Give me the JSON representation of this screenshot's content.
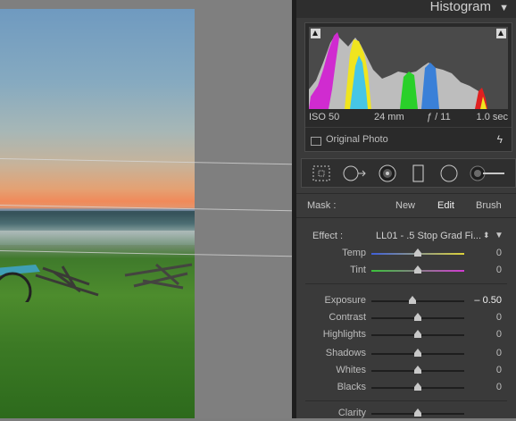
{
  "histogram": {
    "title": "Histogram",
    "exif": {
      "iso": "ISO 50",
      "focal": "24 mm",
      "aperture": "ƒ / 11",
      "shutter": "1.0 sec"
    },
    "original_photo_label": "Original Photo"
  },
  "mask": {
    "label": "Mask :",
    "new": "New",
    "edit": "Edit",
    "brush": "Brush"
  },
  "effect": {
    "label": "Effect :",
    "value": "LL01 - .5 Stop Grad Fi..."
  },
  "sliders": [
    {
      "label": "Temp",
      "value": "0",
      "position": 0.5,
      "track": "temp"
    },
    {
      "label": "Tint",
      "value": "0",
      "position": 0.5,
      "track": "tint"
    },
    {
      "label": "Exposure",
      "value": "– 0.50",
      "position": 0.44,
      "track": "plain",
      "bright": true
    },
    {
      "label": "Contrast",
      "value": "0",
      "position": 0.5,
      "track": "plain"
    },
    {
      "label": "Highlights",
      "value": "0",
      "position": 0.5,
      "track": "plain"
    },
    {
      "label": "Shadows",
      "value": "0",
      "position": 0.5,
      "track": "plain"
    },
    {
      "label": "Whites",
      "value": "0",
      "position": 0.5,
      "track": "plain"
    },
    {
      "label": "Blacks",
      "value": "0",
      "position": 0.5,
      "track": "plain"
    },
    {
      "label": "Clarity",
      "value": "",
      "position": 0.5,
      "track": "plain"
    }
  ],
  "colors": {
    "panel": "#3a3a3a",
    "panel_dark": "#2e2e2e",
    "accent_text": "#f0f0f0"
  },
  "icons": [
    "histogram-toggle-icon",
    "shadow-clip-icon",
    "highlight-clip-icon",
    "bolt-icon",
    "crop-overlay-icon",
    "spot-removal-icon",
    "red-eye-icon",
    "graduated-filter-icon",
    "radial-filter-icon",
    "adjustment-brush-icon",
    "effect-arrows-icon",
    "collapse-icon"
  ]
}
